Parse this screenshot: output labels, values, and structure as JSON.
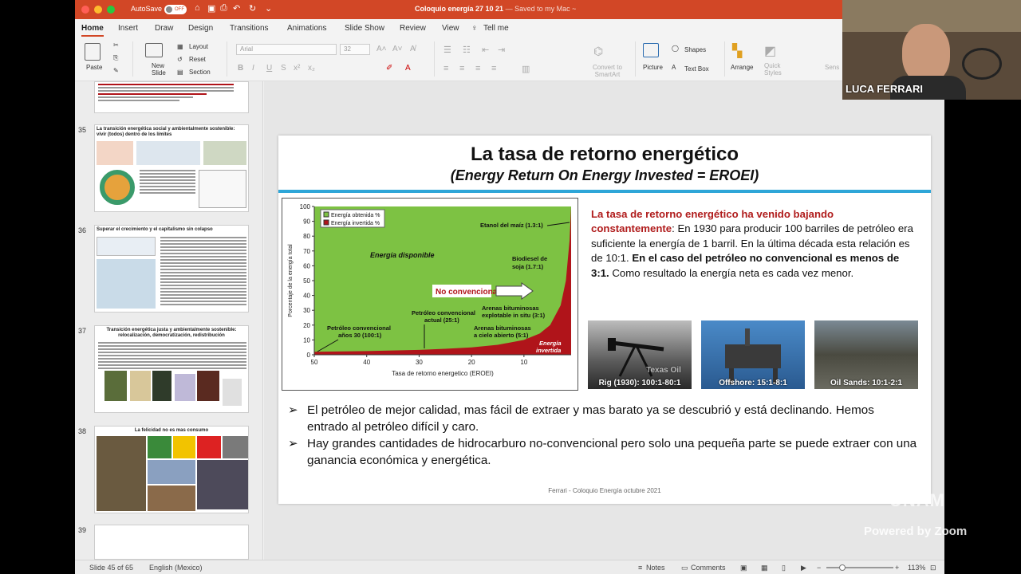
{
  "window": {
    "autosave_label": "AutoSave",
    "autosave_state": "OFF",
    "doc_title": "Coloquio energía 27 10 21",
    "save_status": "— Saved to my Mac ~"
  },
  "tabs": [
    "Home",
    "Insert",
    "Draw",
    "Design",
    "Transitions",
    "Animations",
    "Slide Show",
    "Review",
    "View"
  ],
  "tell_me": "Tell me",
  "ribbon": {
    "paste": "Paste",
    "new_slide": "New\nSlide",
    "layout": "Layout",
    "reset": "Reset",
    "section": "Section",
    "font_name": "Arial",
    "font_size": "32",
    "convert": "Convert to\nSmartArt",
    "picture": "Picture",
    "shapes": "Shapes",
    "text_box": "Text Box",
    "arrange": "Arrange",
    "quick_styles": "Quick\nStyles",
    "sensitivity": "Sens"
  },
  "thumbnails": [
    {
      "num": "",
      "title": ""
    },
    {
      "num": "35",
      "title": "La transición energética social y ambientalmente sostenible:\nvivir (todos) dentro de los límites"
    },
    {
      "num": "36",
      "title": "Superar el crecimiento y el capitalismo sin colapso"
    },
    {
      "num": "37",
      "title": "Transición energética justa y ambientalmente sostenible:\nrelocalización, democratización, redistribución"
    },
    {
      "num": "38",
      "title": "La felicidad no es mas consumo"
    },
    {
      "num": "39",
      "title": ""
    }
  ],
  "slide": {
    "title": "La tasa de retorno energético",
    "subtitle": "(Energy Return On Energy Invested = EROEI)",
    "right_red": "La tasa de retorno energético ha venido bajando constantemente",
    "right_text_1": ": En 1930 para producir 100 barriles de petróleo era suficiente la energía de 1 barril. En la última década esta relación es de 10:1. ",
    "right_bold": "En el caso del petróleo no convencional es menos de 3:1.",
    "right_text_2": " Como resultado la energía neta es cada vez menor.",
    "photos": [
      {
        "caption": "Rig (1930): 100:1-80:1",
        "overlay": "Texas Oil"
      },
      {
        "caption": "Offshore: 15:1-8:1"
      },
      {
        "caption": "Oil Sands: 10:1-2:1"
      }
    ],
    "bullets": [
      "El petróleo de mejor calidad, mas fácil de extraer y mas barato ya se descubrió y está declinando. Hemos entrado al petróleo difícil y caro.",
      "Hay grandes cantidades de hidrocarburo no-convencional pero solo una pequeña parte se puede extraer con una ganancia económica y energética."
    ],
    "bullet_arrow": "➢",
    "footer": "Ferrari - Coloquio Energía octubre 2021"
  },
  "chart_data": {
    "type": "area",
    "xlabel": "Tasa de retorno energetico (EROEI)",
    "ylabel": "Porcentaje de la energía total",
    "x_ticks": [
      "50",
      "40",
      "30",
      "20",
      "10"
    ],
    "y_ticks": [
      "0",
      "10",
      "20",
      "30",
      "40",
      "50",
      "60",
      "70",
      "80",
      "90",
      "100"
    ],
    "xlim": [
      50,
      1
    ],
    "ylim": [
      0,
      100
    ],
    "legend": [
      "Energía obtenida %",
      "Energía invertida %"
    ],
    "series": [
      {
        "name": "Energía obtenida %",
        "x": [
          50,
          40,
          30,
          25,
          20,
          15,
          10,
          7,
          5,
          3,
          2,
          1.3
        ],
        "values": [
          98,
          97.5,
          96.7,
          96,
          95,
          93.3,
          90,
          85.7,
          80,
          66.7,
          50,
          23
        ]
      },
      {
        "name": "Energía invertida %",
        "x": [
          50,
          40,
          30,
          25,
          20,
          15,
          10,
          7,
          5,
          3,
          2,
          1.3
        ],
        "values": [
          2,
          2.5,
          3.3,
          4,
          5,
          6.7,
          10,
          14.3,
          20,
          33.3,
          50,
          77
        ]
      }
    ],
    "annotations": [
      {
        "text": "Energía disponible"
      },
      {
        "text": "No convencional"
      },
      {
        "text": "Etanol del maíz (1.3:1)"
      },
      {
        "text": "Biodiesel de soja (1.7:1)"
      },
      {
        "text": "Arenas bituminosas explotable in situ (3:1)"
      },
      {
        "text": "Arenas bituminosas a cielo abierto (5:1)"
      },
      {
        "text": "Petróleo convencional actual (25:1)"
      },
      {
        "text": "Petróleo convencional años 30 (100:1)"
      },
      {
        "text": "Energía invertida"
      }
    ],
    "colors": {
      "obtained": "#7dc243",
      "invested": "#b0141a"
    }
  },
  "status": {
    "slide_of": "Slide 45 of 65",
    "language": "English (Mexico)",
    "notes": "Notes",
    "comments": "Comments",
    "zoom": "113%"
  },
  "zoom_overlay": {
    "participant": "LUCA FERRARI",
    "powered": "Powered by Zoom",
    "watermark": "UNAM"
  }
}
